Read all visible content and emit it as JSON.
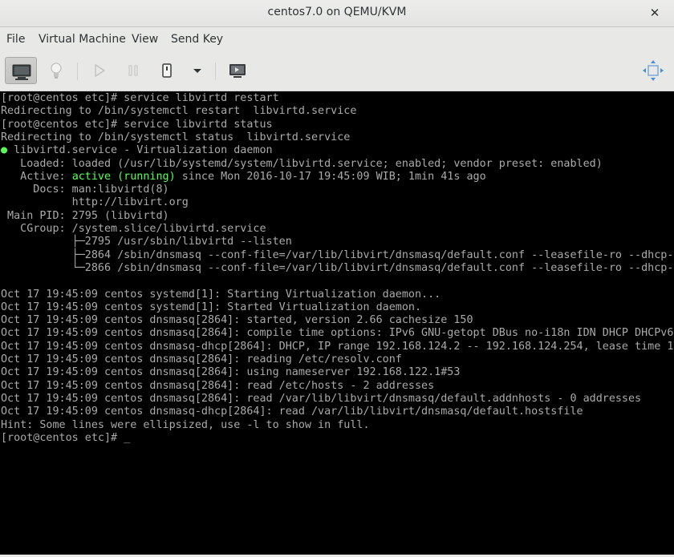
{
  "window": {
    "title": "centos7.0 on QEMU/KVM",
    "close_glyph": "✕"
  },
  "menubar": {
    "items": [
      "File",
      "Virtual Machine",
      "View",
      "Send Key"
    ]
  },
  "toolbar": {
    "buttons": [
      {
        "name": "console-view-icon",
        "state": "active"
      },
      {
        "name": "details-lightbulb-icon",
        "state": "disabled"
      },
      {
        "name": "run-icon",
        "state": "disabled"
      },
      {
        "name": "pause-icon",
        "state": "disabled"
      },
      {
        "name": "shutdown-icon",
        "state": "enabled"
      },
      {
        "name": "shutdown-menu-chevron-icon",
        "state": "enabled"
      },
      {
        "name": "screenshot-monitor-icon",
        "state": "enabled"
      },
      {
        "name": "fullscreen-icon",
        "state": "enabled"
      }
    ]
  },
  "console": {
    "fg_color": "#aaaaaa",
    "highlight_color": "#55ff55",
    "bg_color": "#000000",
    "lines": [
      "[root@centos etc]# service libvirtd restart",
      "Redirecting to /bin/systemctl restart  libvirtd.service",
      "[root@centos etc]# service libvirtd status",
      "Redirecting to /bin/systemctl status  libvirtd.service",
      " libvirtd.service - Virtualization daemon",
      "   Loaded: loaded (/usr/lib/systemd/system/libvirtd.service; enabled; vendor preset: enabled)",
      "   Active: ",
      "     Docs: man:libvirtd(8)",
      "           http://libvirt.org",
      " Main PID: 2795 (libvirtd)",
      "   CGroup: /system.slice/libvirtd.service",
      "           ├─2795 /usr/sbin/libvirtd --listen",
      "           ├─2864 /sbin/dnsmasq --conf-file=/var/lib/libvirt/dnsmasq/default.conf --leasefile-ro --dhcp-",
      "           └─2866 /sbin/dnsmasq --conf-file=/var/lib/libvirt/dnsmasq/default.conf --leasefile-ro --dhcp-",
      "",
      "Oct 17 19:45:09 centos systemd[1]: Starting Virtualization daemon...",
      "Oct 17 19:45:09 centos systemd[1]: Started Virtualization daemon.",
      "Oct 17 19:45:09 centos dnsmasq[2864]: started, version 2.66 cachesize 150",
      "Oct 17 19:45:09 centos dnsmasq[2864]: compile time options: IPv6 GNU-getopt DBus no-i18n IDN DHCP DHCPv6",
      "Oct 17 19:45:09 centos dnsmasq-dhcp[2864]: DHCP, IP range 192.168.124.2 -- 192.168.124.254, lease time 1",
      "Oct 17 19:45:09 centos dnsmasq[2864]: reading /etc/resolv.conf",
      "Oct 17 19:45:09 centos dnsmasq[2864]: using nameserver 192.168.122.1#53",
      "Oct 17 19:45:09 centos dnsmasq[2864]: read /etc/hosts - 2 addresses",
      "Oct 17 19:45:09 centos dnsmasq[2864]: read /var/lib/libvirt/dnsmasq/default.addnhosts - 0 addresses",
      "Oct 17 19:45:09 centos dnsmasq-dhcp[2864]: read /var/lib/libvirt/dnsmasq/default.hostsfile",
      "Hint: Some lines were ellipsized, use -l to show in full.",
      "[root@centos etc]# "
    ],
    "status_dot": "●",
    "active_state": "active (running)",
    "active_since": " since Mon 2016-10-17 19:45:09 WIB; 1min 41s ago",
    "cursor": "_"
  }
}
